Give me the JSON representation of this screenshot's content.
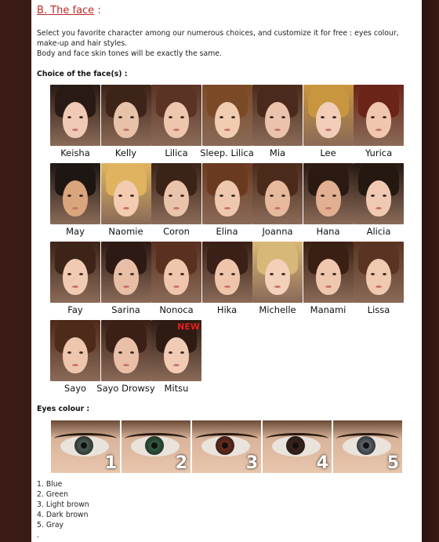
{
  "section": {
    "title": "B. The face",
    "colon": " :"
  },
  "intro": [
    "Select you favorite character among our numerous choices, and customize it for free : eyes colour, make-up and hair styles.",
    "Body and face skin tones will be exactly the same."
  ],
  "faces_heading": "Choice of the face(s) :",
  "faces": [
    {
      "name": "Keisha",
      "hair": "#2a1a14",
      "skin": "#f0c9b5"
    },
    {
      "name": "Kelly",
      "hair": "#3d2418",
      "skin": "#e8c2a8"
    },
    {
      "name": "Lilica",
      "hair": "#5a3324",
      "skin": "#eec5ad"
    },
    {
      "name": "Sleep. Lilica",
      "hair": "#7a4a26",
      "skin": "#f0cdb0"
    },
    {
      "name": "Mia",
      "hair": "#4a2a1c",
      "skin": "#ebc3ad"
    },
    {
      "name": "Lee",
      "hair": "#c8963e",
      "skin": "#f2cdb8"
    },
    {
      "name": "Yurica",
      "hair": "#6a2418",
      "skin": "#f0c6ae"
    },
    {
      "name": "May",
      "hair": "#1e1612",
      "skin": "#d9a57c"
    },
    {
      "name": "Naomie",
      "hair": "#e0b45e",
      "skin": "#f2cbb0"
    },
    {
      "name": "Coron",
      "hair": "#3a2418",
      "skin": "#eac3ab"
    },
    {
      "name": "Elina",
      "hair": "#6a3a20",
      "skin": "#eec7ae"
    },
    {
      "name": "Joanna",
      "hair": "#4a2a1a",
      "skin": "#e6b99c"
    },
    {
      "name": "Hana",
      "hair": "#2a1a12",
      "skin": "#e0b090"
    },
    {
      "name": "Alicia",
      "hair": "#241810",
      "skin": "#efc9b2"
    },
    {
      "name": "Fay",
      "hair": "#3e2418",
      "skin": "#f0cab2"
    },
    {
      "name": "Sarina",
      "hair": "#2e1a14",
      "skin": "#e8bfa6"
    },
    {
      "name": "Nonoca",
      "hair": "#5a3020",
      "skin": "#efc6ad"
    },
    {
      "name": "Hika",
      "hair": "#3a2016",
      "skin": "#eec4ab"
    },
    {
      "name": "Michelle",
      "hair": "#d8b878",
      "skin": "#f3d0b9"
    },
    {
      "name": "Manami",
      "hair": "#3a2014",
      "skin": "#efc6ae"
    },
    {
      "name": "Lissa",
      "hair": "#5a3422",
      "skin": "#f0c9b1"
    },
    {
      "name": "Sayo",
      "hair": "#4e2a1a",
      "skin": "#eec5ad"
    },
    {
      "name": "Sayo Drowsy",
      "hair": "#3a2016",
      "skin": "#e9c0a7"
    },
    {
      "name": "Mitsu",
      "hair": "#2e1c14",
      "skin": "#f1cbb4",
      "badge": "NEW"
    }
  ],
  "eyes_heading": "Eyes colour :",
  "eye_colours": [
    {
      "num": "1",
      "iris": "#4a5a52"
    },
    {
      "num": "2",
      "iris": "#2f5a3e"
    },
    {
      "num": "3",
      "iris": "#6a2a1a"
    },
    {
      "num": "4",
      "iris": "#3a221a"
    },
    {
      "num": "5",
      "iris": "#5a6268"
    }
  ],
  "eye_list": [
    "1. Blue",
    "2. Green",
    "3. Light brown",
    "4. Dark brown",
    "5. Gray",
    "."
  ],
  "colors": {
    "title_red": "#c0292a",
    "new_badge": "#e0201c",
    "frame": "#3a1a14"
  }
}
